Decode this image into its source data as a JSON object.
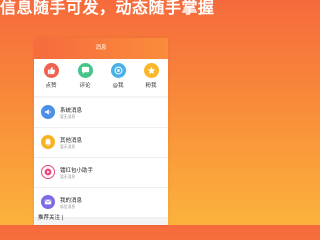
{
  "headline": "信息随手可发，动态随手掌握",
  "screen": {
    "title": "消息"
  },
  "quick_actions": [
    {
      "label": "点赞",
      "icon": "thumbs-up-icon",
      "color": "#f0614e"
    },
    {
      "label": "评论",
      "icon": "comment-icon",
      "color": "#46c48a"
    },
    {
      "label": "@我",
      "icon": "mention-icon",
      "color": "#4ab0e8"
    },
    {
      "label": "粉我",
      "icon": "star-icon",
      "color": "#f8b72a"
    }
  ],
  "messages": [
    {
      "title": "系统消息",
      "subtitle": "暂无消息",
      "icon": "speaker-icon",
      "color": "#4a90e8"
    },
    {
      "title": "其他消息",
      "subtitle": "暂无消息",
      "icon": "bell-icon",
      "color": "#f6b422"
    },
    {
      "title": "镭红包小助手",
      "subtitle": "暂无消息",
      "icon": "play-icon",
      "color": "#e9477a"
    },
    {
      "title": "我的消息",
      "subtitle": "私信消息",
      "icon": "mail-icon",
      "color": "#7c6ae6"
    }
  ],
  "recommend_label": "推荐关注 |"
}
